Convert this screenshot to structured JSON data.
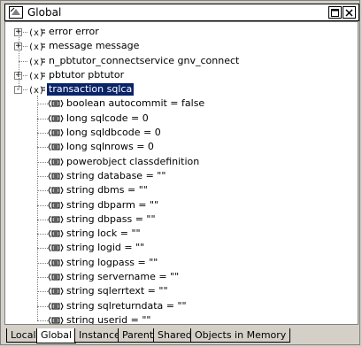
{
  "window": {
    "title": "Global"
  },
  "tree": [
    {
      "label": "error error",
      "level": 0,
      "expander": "+",
      "icon": "variable-icon"
    },
    {
      "label": "message message",
      "level": 0,
      "expander": "+",
      "icon": "variable-icon"
    },
    {
      "label": "n_pbtutor_connectservice gnv_connect",
      "level": 0,
      "expander": "",
      "icon": "variable-icon"
    },
    {
      "label": "pbtutor pbtutor",
      "level": 0,
      "expander": "+",
      "icon": "variable-icon"
    },
    {
      "label": "transaction sqlca",
      "level": 0,
      "expander": "-",
      "icon": "variable-icon",
      "selected": true
    },
    {
      "label": "boolean autocommit =  false",
      "level": 1,
      "icon": "property-icon"
    },
    {
      "label": "long sqlcode =  0",
      "level": 1,
      "icon": "property-icon"
    },
    {
      "label": "long sqldbcode =  0",
      "level": 1,
      "icon": "property-icon"
    },
    {
      "label": "long sqlnrows =  0",
      "level": 1,
      "icon": "property-icon"
    },
    {
      "label": "powerobject classdefinition",
      "level": 1,
      "icon": "property-icon"
    },
    {
      "label": "string database =  \"\"",
      "level": 1,
      "icon": "property-icon"
    },
    {
      "label": "string dbms =  \"\"",
      "level": 1,
      "icon": "property-icon"
    },
    {
      "label": "string dbparm =  \"\"",
      "level": 1,
      "icon": "property-icon"
    },
    {
      "label": "string dbpass =  \"\"",
      "level": 1,
      "icon": "property-icon"
    },
    {
      "label": "string lock =  \"\"",
      "level": 1,
      "icon": "property-icon"
    },
    {
      "label": "string logid =  \"\"",
      "level": 1,
      "icon": "property-icon"
    },
    {
      "label": "string logpass =  \"\"",
      "level": 1,
      "icon": "property-icon"
    },
    {
      "label": "string servername =  \"\"",
      "level": 1,
      "icon": "property-icon"
    },
    {
      "label": "string sqlerrtext =  \"\"",
      "level": 1,
      "icon": "property-icon"
    },
    {
      "label": "string sqlreturndata =  \"\"",
      "level": 1,
      "icon": "property-icon"
    },
    {
      "label": "string userid =  \"\"",
      "level": 1,
      "icon": "property-icon"
    }
  ],
  "tabs": [
    {
      "label": "Local",
      "active": false
    },
    {
      "label": "Global",
      "active": true
    },
    {
      "label": "Instance",
      "active": false
    },
    {
      "label": "Parent",
      "active": false
    },
    {
      "label": "Shared",
      "active": false
    },
    {
      "label": "Objects in Memory",
      "active": false
    }
  ]
}
